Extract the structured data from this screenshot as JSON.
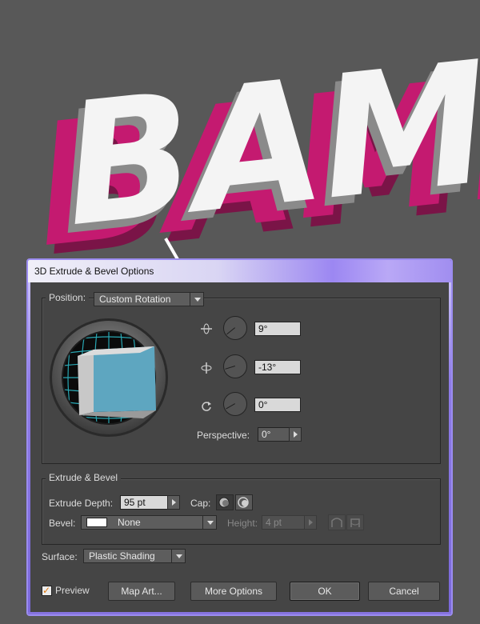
{
  "artwork": {
    "text": "BAM!",
    "colors": {
      "face": "#f4f4f4",
      "shadow": "#8a8a8a",
      "extrude": "#c41a70",
      "deep": "#7a1447"
    }
  },
  "dialog": {
    "title": "3D Extrude & Bevel Options",
    "position": {
      "label": "Position:",
      "value": "Custom Rotation",
      "x_axis": {
        "icon": "rotate-x-axis-icon",
        "value": "9°",
        "angle": 9
      },
      "y_axis": {
        "icon": "rotate-y-axis-icon",
        "value": "-13°",
        "angle": -13
      },
      "z_axis": {
        "icon": "rotate-z-axis-icon",
        "value": "0°",
        "angle": 0
      },
      "perspective_label": "Perspective:",
      "perspective_value": "0°"
    },
    "extrude_bevel": {
      "legend": "Extrude & Bevel",
      "depth_label": "Extrude Depth:",
      "depth_value": "95 pt",
      "cap_label": "Cap:",
      "bevel_label": "Bevel:",
      "bevel_value": "None",
      "height_label": "Height:",
      "height_value": "4 pt"
    },
    "surface": {
      "label": "Surface:",
      "value": "Plastic Shading"
    },
    "footer": {
      "preview_label": "Preview",
      "preview_checked": true,
      "map_art": "Map Art...",
      "more_options": "More Options",
      "ok": "OK",
      "cancel": "Cancel"
    },
    "colors": {
      "accent": "#9b8cf0",
      "trackball_grid": "#29a7b3",
      "cube_face": "#5ea6c0"
    }
  }
}
